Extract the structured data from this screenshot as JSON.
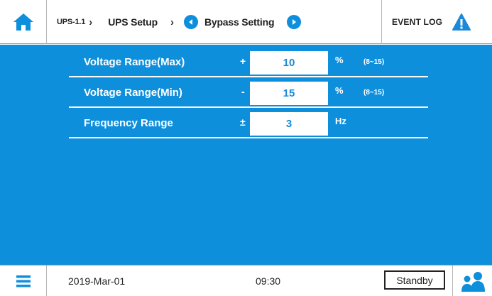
{
  "header": {
    "breadcrumb": {
      "device": "UPS-1.1",
      "section": "UPS Setup",
      "page": "Bypass Setting"
    },
    "event_log_label": "EVENT LOG"
  },
  "settings": [
    {
      "label": "Voltage Range(Max)",
      "sign": "+",
      "value": "10",
      "unit": "%",
      "range": "(8~15)"
    },
    {
      "label": "Voltage Range(Min)",
      "sign": "-",
      "value": "15",
      "unit": "%",
      "range": "(8~15)"
    },
    {
      "label": "Frequency Range",
      "sign": "±",
      "value": "3",
      "unit": "Hz",
      "range": ""
    }
  ],
  "footer": {
    "date": "2019-Mar-01",
    "time": "09:30",
    "status": "Standby"
  },
  "icons": {
    "home": "home-icon",
    "prev": "chevron-left-circle-icon",
    "next": "chevron-right-circle-icon",
    "warning": "warning-icon",
    "menu": "hamburger-menu-icon",
    "users": "users-icon"
  },
  "colors": {
    "accent": "#0e8fdc",
    "warning": "#1a8ad8"
  }
}
